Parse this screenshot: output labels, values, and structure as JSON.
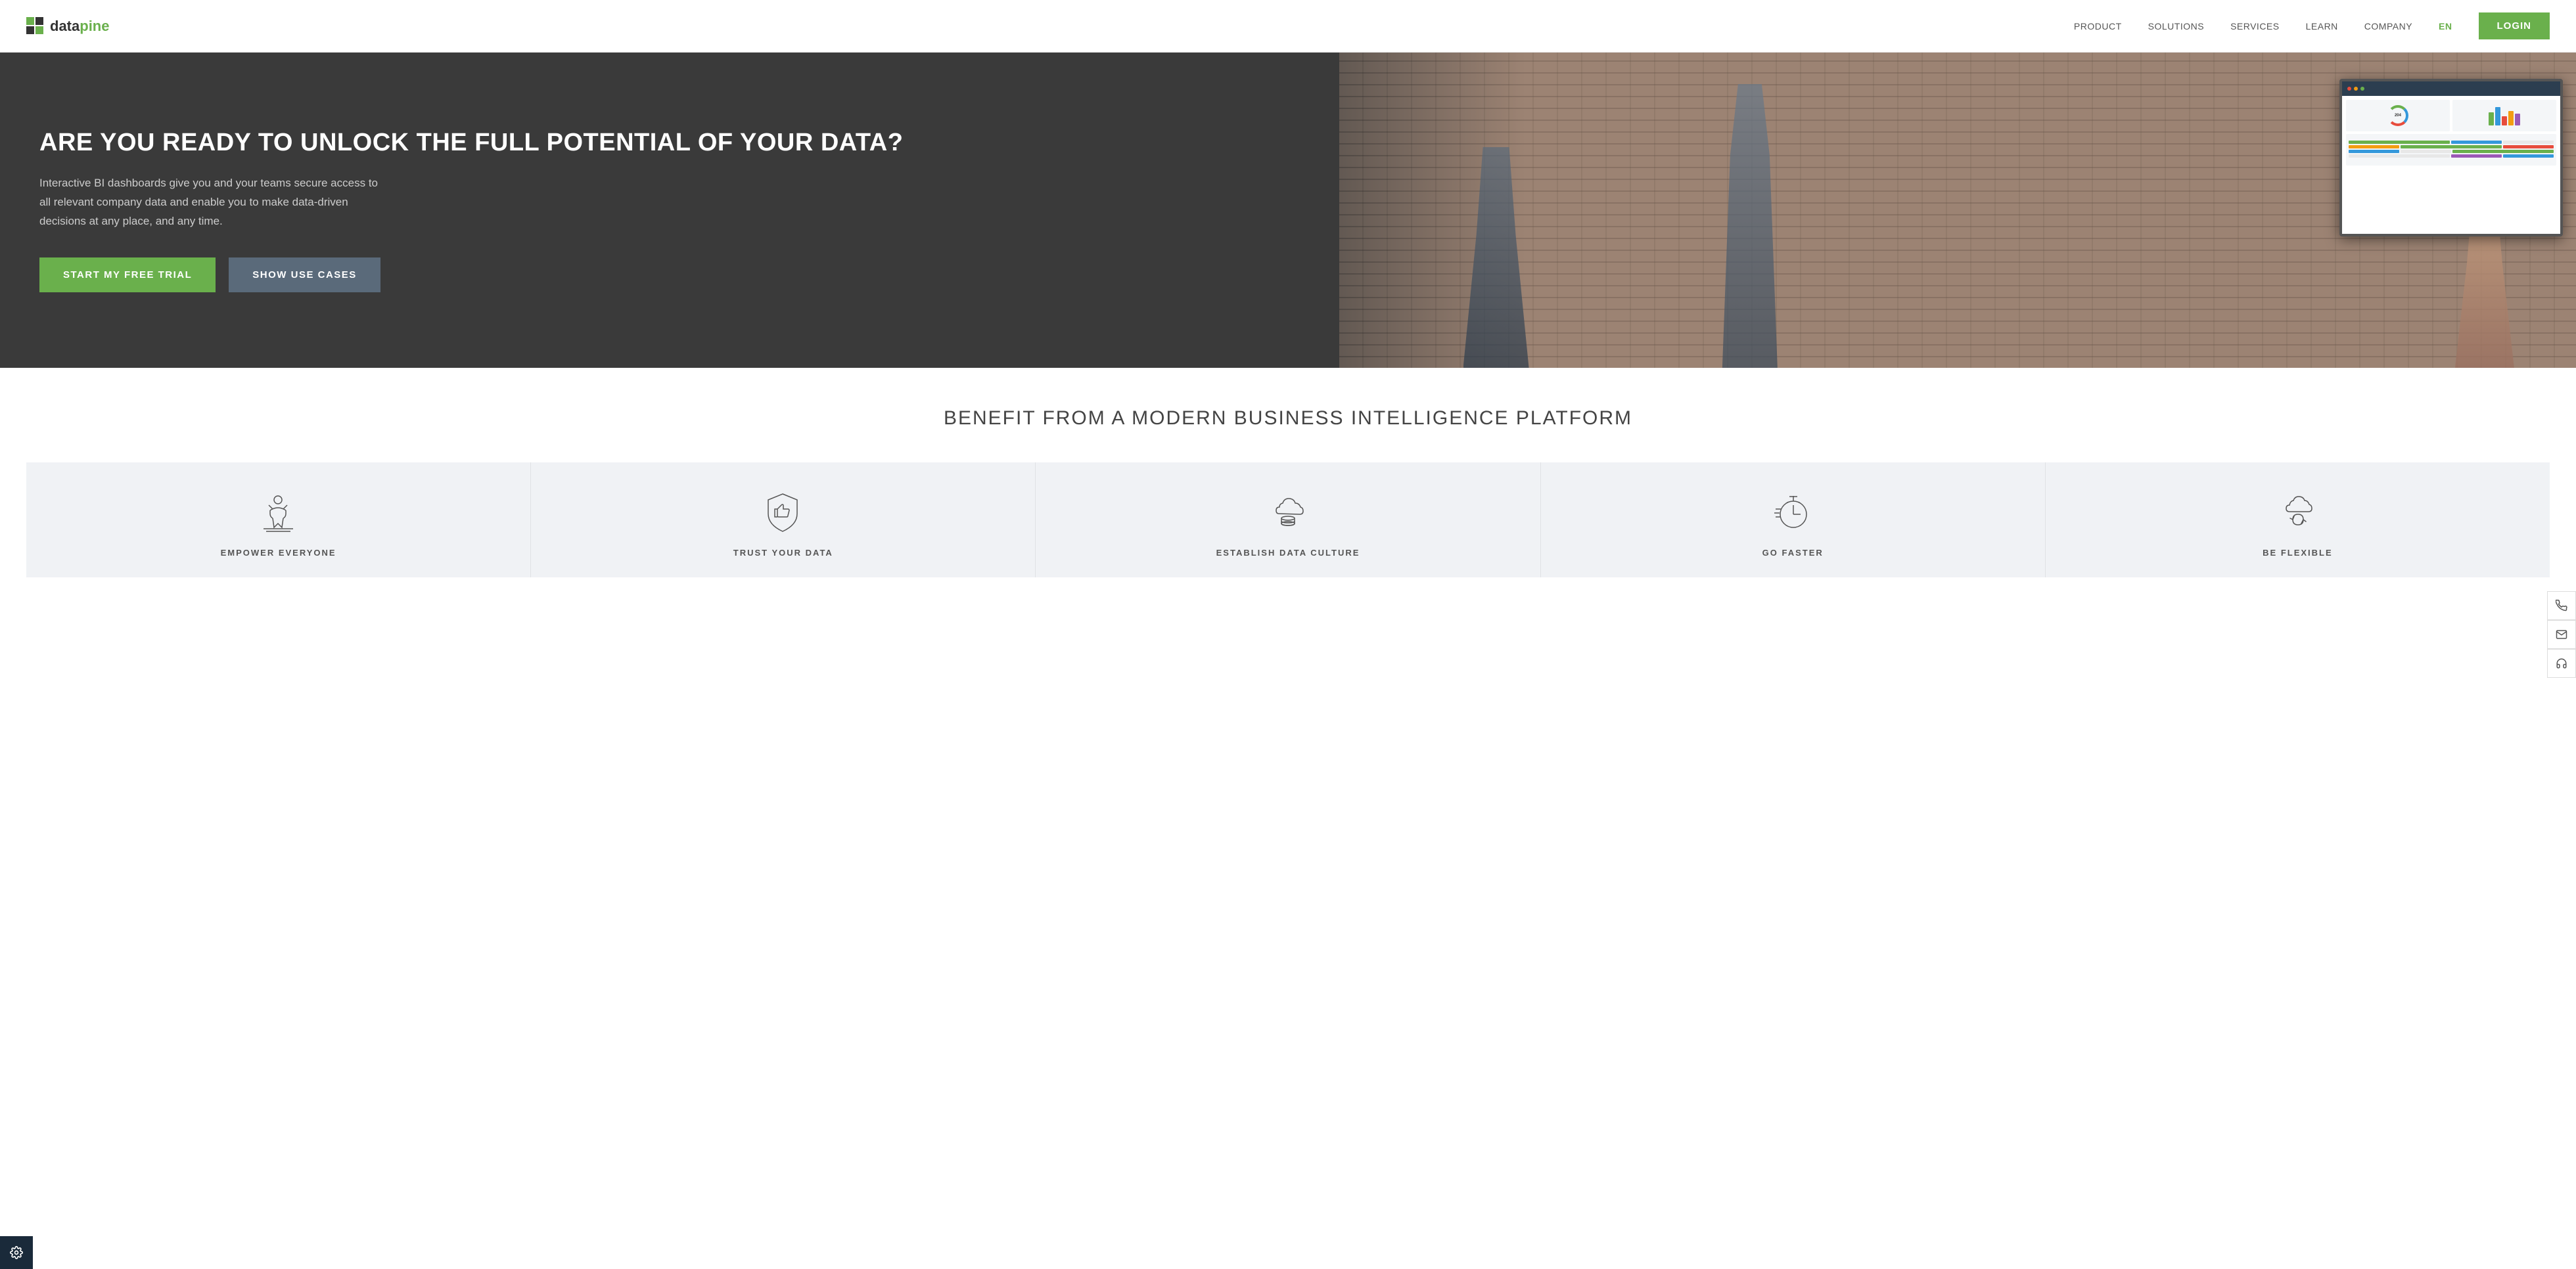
{
  "header": {
    "logo_text_data": "data",
    "logo_text_pine": "pine",
    "nav_items": [
      {
        "label": "PRODUCT",
        "id": "nav-product"
      },
      {
        "label": "SOLUTIONS",
        "id": "nav-solutions"
      },
      {
        "label": "SERVICES",
        "id": "nav-services"
      },
      {
        "label": "LEARN",
        "id": "nav-learn"
      },
      {
        "label": "COMPANY",
        "id": "nav-company"
      }
    ],
    "lang": "EN",
    "login": "LOGIN"
  },
  "hero": {
    "title": "ARE YOU READY TO UNLOCK THE FULL POTENTIAL OF YOUR DATA?",
    "subtitle": "Interactive BI dashboards give you and your teams secure access to all relevant company data and enable you to make data-driven decisions at any place, and any time.",
    "btn_primary": "START MY FREE TRIAL",
    "btn_secondary": "SHOW USE CASES"
  },
  "benefits": {
    "title": "BENEFIT FROM A MODERN BUSINESS INTELLIGENCE PLATFORM",
    "cards": [
      {
        "id": "empower",
        "label": "EMPOWER EVERYONE",
        "icon": "empower-icon"
      },
      {
        "id": "trust",
        "label": "TRUST YOUR DATA",
        "icon": "trust-icon"
      },
      {
        "id": "establish",
        "label": "ESTABLISH DATA CULTURE",
        "icon": "culture-icon"
      },
      {
        "id": "faster",
        "label": "GO FASTER",
        "icon": "faster-icon"
      },
      {
        "id": "flexible",
        "label": "BE FLEXIBLE",
        "icon": "flexible-icon"
      }
    ]
  },
  "side_icons": [
    {
      "label": "phone",
      "icon": "phone-icon"
    },
    {
      "label": "email",
      "icon": "email-icon"
    },
    {
      "label": "headset",
      "icon": "headset-icon"
    }
  ],
  "colors": {
    "green": "#6ab04c",
    "dark_hero": "#3a3a3a",
    "mid_blue": "#5a6a7a",
    "card_bg": "#f0f2f5"
  }
}
